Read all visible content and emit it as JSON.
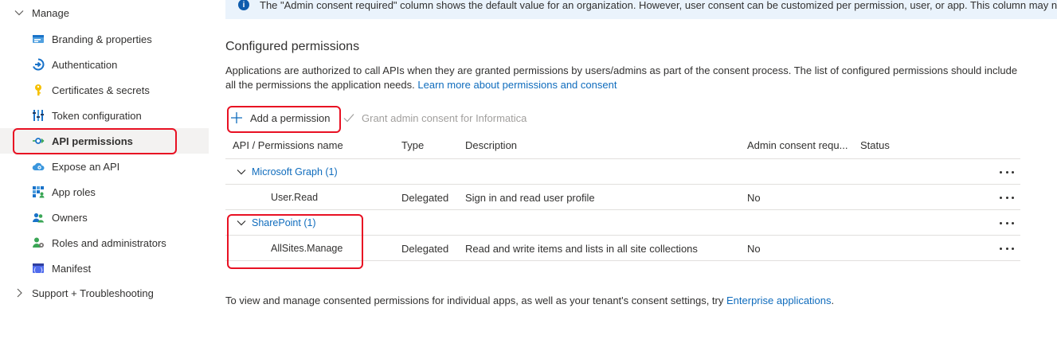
{
  "sidebar": {
    "manage_label": "Manage",
    "items": [
      {
        "label": "Branding & properties",
        "icon": "branding-icon"
      },
      {
        "label": "Authentication",
        "icon": "authentication-icon"
      },
      {
        "label": "Certificates & secrets",
        "icon": "key-icon"
      },
      {
        "label": "Token configuration",
        "icon": "token-icon"
      },
      {
        "label": "API permissions",
        "icon": "api-permissions-icon",
        "active": true
      },
      {
        "label": "Expose an API",
        "icon": "cloud-icon"
      },
      {
        "label": "App roles",
        "icon": "app-roles-icon"
      },
      {
        "label": "Owners",
        "icon": "owners-icon"
      },
      {
        "label": "Roles and administrators",
        "icon": "roles-icon"
      },
      {
        "label": "Manifest",
        "icon": "manifest-icon"
      }
    ],
    "support_label": "Support + Troubleshooting"
  },
  "info_bar": {
    "text": "The \"Admin consent required\" column shows the default value for an organization. However, user consent can be customized per permission, user, or app. This column may not reflect the val"
  },
  "main": {
    "title": "Configured permissions",
    "description": "Applications are authorized to call APIs when they are granted permissions by users/admins as part of the consent process. The list of configured permissions should include all the permissions the application needs.",
    "learn_more_link": "Learn more about permissions and consent",
    "toolbar": {
      "add_permission": "Add a permission",
      "grant_consent": "Grant admin consent for Informatica"
    },
    "table": {
      "headers": {
        "name": "API / Permissions name",
        "type": "Type",
        "description": "Description",
        "admin_consent": "Admin consent requ...",
        "status": "Status"
      },
      "groups": [
        {
          "name": "Microsoft Graph (1)",
          "rows": [
            {
              "name": "User.Read",
              "type": "Delegated",
              "description": "Sign in and read user profile",
              "admin_consent": "No",
              "status": ""
            }
          ]
        },
        {
          "name": "SharePoint (1)",
          "rows": [
            {
              "name": "AllSites.Manage",
              "type": "Delegated",
              "description": "Read and write items and lists in all site collections",
              "admin_consent": "No",
              "status": ""
            }
          ]
        }
      ]
    },
    "footer_text": "To view and manage consented permissions for individual apps, as well as your tenant's consent settings, try",
    "footer_link": "Enterprise applications",
    "footer_period": "."
  },
  "colors": {
    "accent": "#0f6cbd",
    "highlight_box": "#e81123",
    "info_bg": "#eaf3fc"
  }
}
